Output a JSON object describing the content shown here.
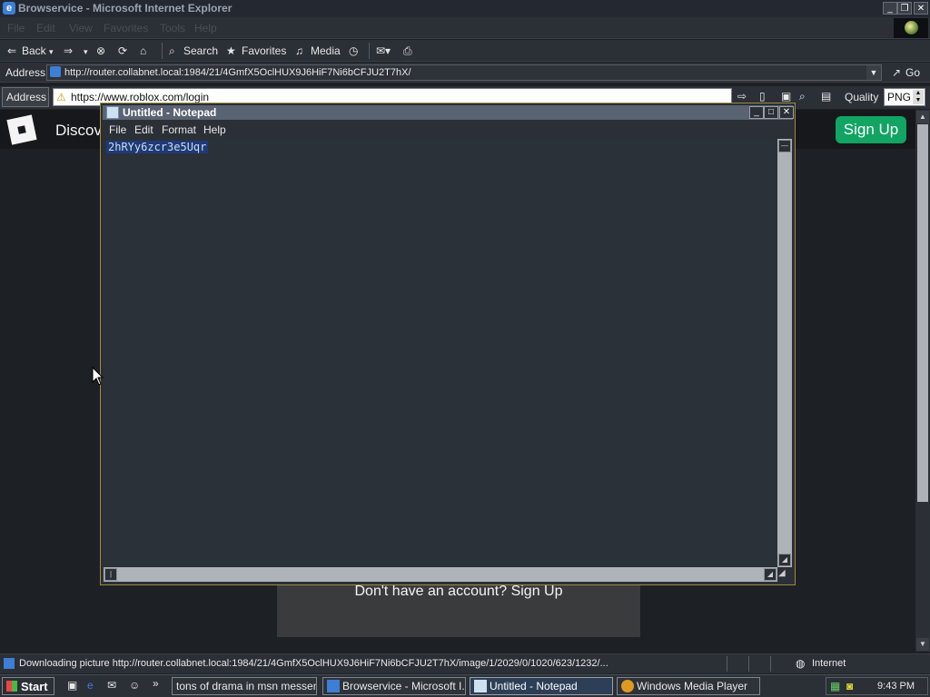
{
  "window": {
    "title": "Browservice - Microsoft Internet Explorer"
  },
  "menubar": {
    "items": [
      "File",
      "Edit",
      "View",
      "Favorites",
      "Tools",
      "Help"
    ]
  },
  "toolbar": {
    "back": "Back",
    "search": "Search",
    "favorites": "Favorites",
    "media": "Media"
  },
  "address": {
    "label": "Address",
    "value": "http://router.collabnet.local:1984/21/4GmfX5OclHUX9J6HiF7Ni6bCFJU2T7hX/",
    "go": "Go"
  },
  "browservice": {
    "address_label": "Address",
    "address_value": "https://www.roblox.com/login",
    "quality_label": "Quality",
    "quality_value": "PNG"
  },
  "page": {
    "nav_discover": "Discover",
    "signup_button": "Sign Up",
    "no_account_text": "Don't have an account?",
    "signup_link": "Sign Up"
  },
  "notepad": {
    "title": "Untitled - Notepad",
    "menu": [
      "File",
      "Edit",
      "Format",
      "Help"
    ],
    "text": "2hRYy6zcr3e5Uqr"
  },
  "statusbar": {
    "text": "Downloading picture http://router.collabnet.local:1984/21/4GmfX5OclHUX9J6HiF7Ni6bCFJU2T7hX/image/1/2029/0/1020/623/1232/...",
    "zone": "Internet"
  },
  "taskbar": {
    "start": "Start",
    "tasks": [
      "tons of drama in msn messen...",
      "Browservice - Microsoft I...",
      "Untitled - Notepad",
      "Windows Media Player"
    ],
    "clock": "9:43 PM"
  },
  "colors": {
    "accent_green": "#11a463",
    "selection": "#1f3a78"
  }
}
